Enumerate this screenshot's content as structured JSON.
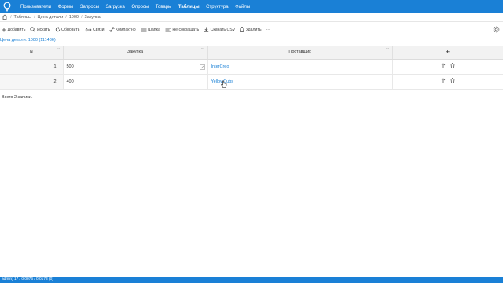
{
  "nav": {
    "items": [
      "Пользователи",
      "Формы",
      "Запросы",
      "Загрузка",
      "Опросы",
      "Товары",
      "Таблицы",
      "Структура",
      "Файлы"
    ],
    "active": "Таблицы"
  },
  "breadcrumb": [
    "Таблицы",
    "Цена детали",
    "1000",
    "Закупка"
  ],
  "toolbar": {
    "add": "Добавить",
    "search": "Искать",
    "refresh": "Обновить",
    "link": "Связи",
    "compact": "Компактно",
    "header": "Шапка",
    "no_shorten": "Не сокращать",
    "download_csv": "Скачать CSV",
    "delete": "Удалить",
    "more": "···"
  },
  "caption": "Цена детали: 1000 (111436)",
  "table": {
    "columns": [
      "N",
      "Закупка",
      "Поставщик"
    ],
    "add_column": "+",
    "rows": [
      {
        "n": "1",
        "purchase": "500",
        "supplier": "InterCreo"
      },
      {
        "n": "2",
        "purchase": "400",
        "supplier": "YellowCubs"
      }
    ]
  },
  "total": "Всего 2 записи.",
  "status": "admin) 17 / 0.0076 / 0.0173 (0)",
  "colors": {
    "accent": "#1a80d6",
    "header_bg": "#f2f2f2"
  }
}
